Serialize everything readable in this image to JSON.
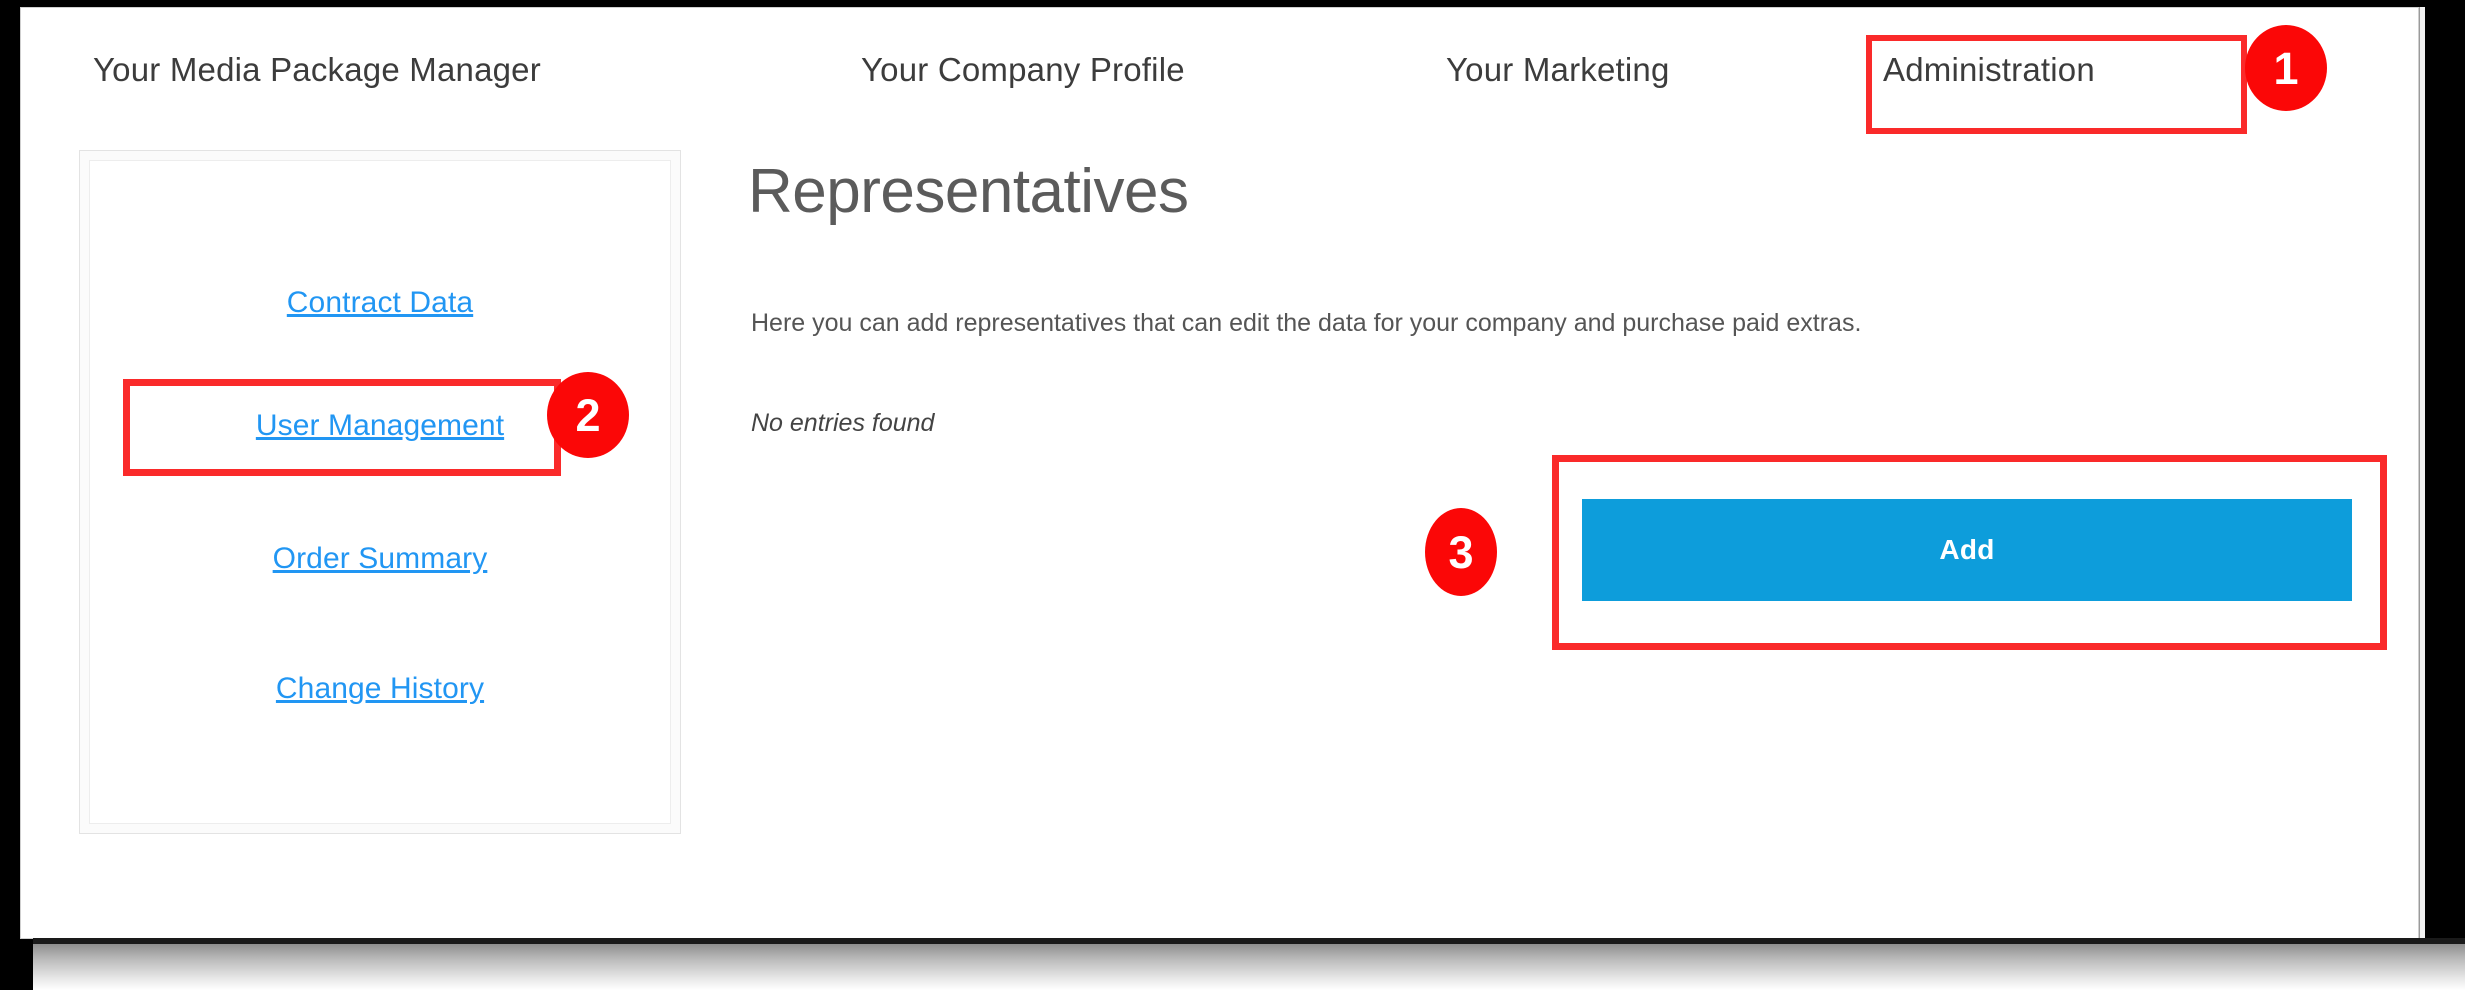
{
  "topnav": {
    "items": [
      {
        "label": "Your Media Package Manager",
        "name": "nav-item-media-package-manager"
      },
      {
        "label": "Your Company Profile",
        "name": "nav-item-company-profile"
      },
      {
        "label": "Your Marketing",
        "name": "nav-item-marketing"
      },
      {
        "label": "Administration",
        "name": "nav-item-administration"
      }
    ]
  },
  "sidebar": {
    "items": [
      {
        "label": "Contract Data"
      },
      {
        "label": "User Management"
      },
      {
        "label": "Order Summary"
      },
      {
        "label": "Change History"
      }
    ]
  },
  "main": {
    "title": "Representatives",
    "description": "Here you can add representatives that can edit the data for your company and purchase paid extras.",
    "empty_state": "No entries found",
    "add_button_label": "Add"
  },
  "annotations": {
    "steps": [
      {
        "number": "1",
        "target": "Administration"
      },
      {
        "number": "2",
        "target": "User Management"
      },
      {
        "number": "3",
        "target": "Add"
      }
    ]
  },
  "colors": {
    "link_blue": "#2196f3",
    "button_blue": "#0d9ddb",
    "annotation_red": "#fa2a2a",
    "badge_red": "#fb0707",
    "nav_text": "#3c3c3c",
    "title_gray": "#5b5b5b"
  }
}
